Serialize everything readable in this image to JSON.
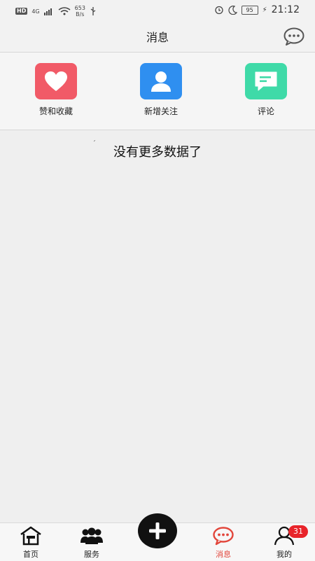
{
  "status_bar": {
    "hd": "HD",
    "network": "4G",
    "speed_value": "653",
    "speed_unit": "B/s",
    "battery": "95",
    "time": "21:12"
  },
  "header": {
    "title": "消息",
    "chat_icon": "chat-bubble-icon"
  },
  "categories": [
    {
      "label": "赞和收藏",
      "icon": "heart-icon",
      "color": "#f15a67"
    },
    {
      "label": "新增关注",
      "icon": "user-icon",
      "color": "#2f8ff0"
    },
    {
      "label": "评论",
      "icon": "comment-icon",
      "color": "#3fdaa8"
    }
  ],
  "empty_text": "没有更多数据了",
  "bottom_nav": {
    "items": [
      {
        "label": "首页",
        "icon": "home-icon"
      },
      {
        "label": "服务",
        "icon": "users-icon"
      },
      {
        "label": "消息",
        "icon": "message-icon",
        "active": true
      },
      {
        "label": "我的",
        "icon": "profile-icon",
        "badge": "31"
      }
    ],
    "post_icon": "plus-icon",
    "active_color": "#e2463b"
  }
}
